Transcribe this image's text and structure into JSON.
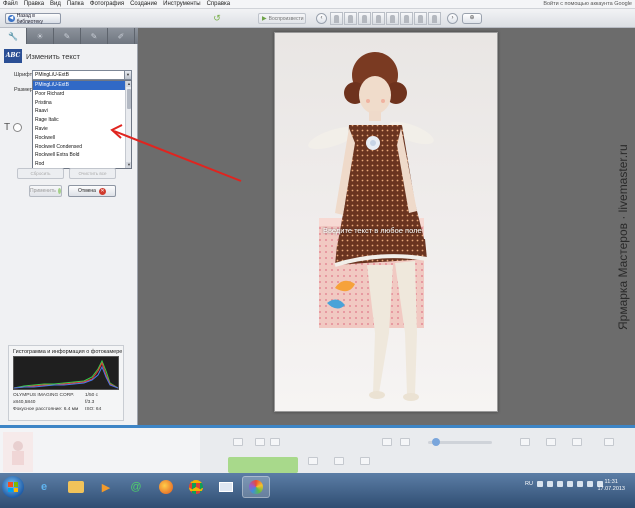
{
  "menu": {
    "items": [
      "Файл",
      "Правка",
      "Вид",
      "Папка",
      "Фотография",
      "Создание",
      "Инструменты",
      "Справка"
    ],
    "sign_in": "Войти с помощью аккаунта Google"
  },
  "toolbar": {
    "back_label": "Назад в библиотеку",
    "play_label": "Воспроизвести"
  },
  "panel": {
    "title": "Изменить текст",
    "icon_label": "ABC",
    "font_label": "Шрифт:",
    "size_label": "Размер:",
    "font_selected": "PMingLiU-ExtB",
    "font_options": [
      "PMingLiU-ExtB",
      "Poor Richard",
      "Pristina",
      "Raavi",
      "Rage Italic",
      "Ravie",
      "Rockwell",
      "Rockwell Condensed",
      "Rockwell Extra Bold",
      "Rod"
    ],
    "style_letter": "T",
    "ghost_left": "Сбросить",
    "ghost_right": "Очистить все",
    "apply_label": "Применить",
    "cancel_label": "Отмена"
  },
  "histogram": {
    "title": "Гистограмма и информация о фотокамере",
    "camera": "OLYMPUS IMAGING CORP.",
    "shutter": "1/50 с",
    "resolution": "x840,5840",
    "aperture": "f/3.3",
    "focal": "Фокусное расстояние: 6.4 мм",
    "iso": "ISO: 64"
  },
  "canvas": {
    "overlay_text": "Введите текст в любое поле"
  },
  "watermark": "Ярмарка Мастеров · livemaster.ru",
  "taskbar": {
    "lang": "RU",
    "time": "11:31",
    "date": "17.07.2013"
  },
  "colors": {
    "accent": "#3d85c6",
    "selection": "#3169c6",
    "arrow": "#e0241f"
  }
}
